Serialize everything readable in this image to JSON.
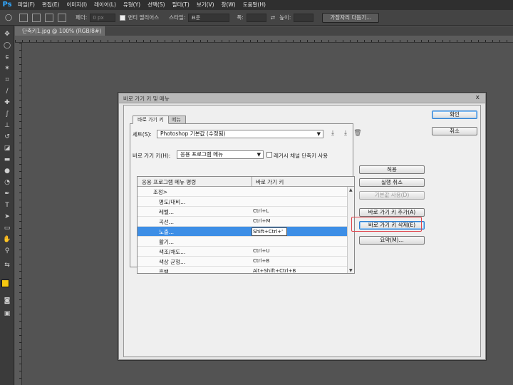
{
  "menubar": {
    "logo": "Ps",
    "items": [
      "파일(F)",
      "편집(E)",
      "이미지(I)",
      "레이어(L)",
      "유형(Y)",
      "선택(S)",
      "필터(T)",
      "보기(V)",
      "창(W)",
      "도움말(H)"
    ]
  },
  "options": {
    "feather_label": "페더:",
    "feather_value": "0 px",
    "antialias_label": "앤티 앨리어스",
    "style_label": "스타일:",
    "style_value": "표준",
    "width_label": "폭:",
    "height_label": "높이:",
    "refine_button": "가장자리 다듬기..."
  },
  "document": {
    "tab_label": "단축키1.jpg @ 100% (RGB/8#)",
    "close_glyph": "×"
  },
  "dialog": {
    "title": "바로 가기 키 및 메뉴",
    "close_glyph": "x",
    "tabs": [
      "바로 가기 키",
      "메뉴"
    ],
    "set_label": "세트(S):",
    "set_value": "Photoshop 기본값 (수정됨)",
    "shortcuts_for_label": "바로 가기 키(H):",
    "shortcuts_for_value": "응용 프로그램 메뉴",
    "legacy_label": "레거시 채널 단축키 사용",
    "table": {
      "col_name": "응용 프로그램 메뉴 명령",
      "col_key": "바로 가기 키",
      "rows": [
        {
          "name": "조정>",
          "key": "",
          "indent": 1
        },
        {
          "name": "명도/대비...",
          "key": "",
          "indent": 2
        },
        {
          "name": "레벨...",
          "key": "Ctrl+L",
          "indent": 2
        },
        {
          "name": "곡선...",
          "key": "Ctrl+M",
          "indent": 2
        },
        {
          "name": "노출...",
          "key": "Shift+Ctrl+'",
          "indent": 2,
          "selected": true
        },
        {
          "name": "활기...",
          "key": "",
          "indent": 2
        },
        {
          "name": "색조/채도...",
          "key": "Ctrl+U",
          "indent": 2
        },
        {
          "name": "색상 균형...",
          "key": "Ctrl+B",
          "indent": 2
        },
        {
          "name": "흑백...",
          "key": "Alt+Shift+Ctrl+B",
          "indent": 2
        }
      ]
    },
    "buttons": {
      "ok": "확인",
      "cancel": "취소",
      "accept": "허용",
      "undo": "실행 취소",
      "use_default": "기본값 사용(D)",
      "add_shortcut": "바로 가기 키 추가(A)",
      "delete_shortcut": "바로 가기 키 삭제(E)",
      "summarize": "요약(M)..."
    }
  },
  "colors": {
    "foreground": "#f6c911",
    "background": "#ffffff",
    "selection": "#3d8ee6",
    "highlight_box": "#e0444c"
  }
}
